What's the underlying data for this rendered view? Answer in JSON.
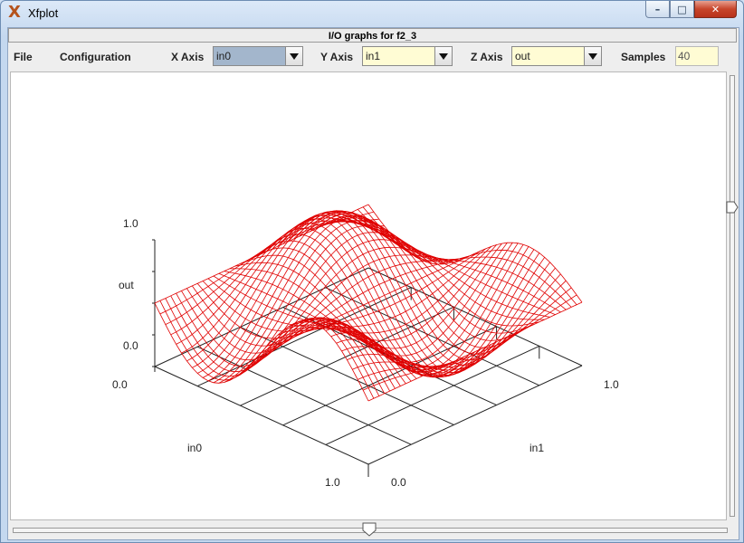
{
  "window": {
    "title": "Xfplot",
    "icon": "x-logo-icon"
  },
  "header": {
    "title": "I/O graphs for f2_3"
  },
  "toolbar": {
    "file_label": "File",
    "configuration_label": "Configuration",
    "x_axis_label": "X Axis",
    "x_axis_value": "in0",
    "y_axis_label": "Y Axis",
    "y_axis_value": "in1",
    "z_axis_label": "Z Axis",
    "z_axis_value": "out",
    "samples_label": "Samples",
    "samples_value": "40"
  },
  "plot": {
    "z_axis_max": "1.0",
    "z_axis_name": "out",
    "z_axis_min": "0.0",
    "in0_min": "0.0",
    "in0_name": "in0",
    "in0_max": "1.0",
    "in1_min": "0.0",
    "in1_name": "in1",
    "in1_max": "1.0",
    "mesh_color": "#e00000",
    "grid_divisions": 5,
    "samples": 40
  },
  "scroll": {
    "vertical_position": 0.3,
    "horizontal_position": 0.5
  }
}
